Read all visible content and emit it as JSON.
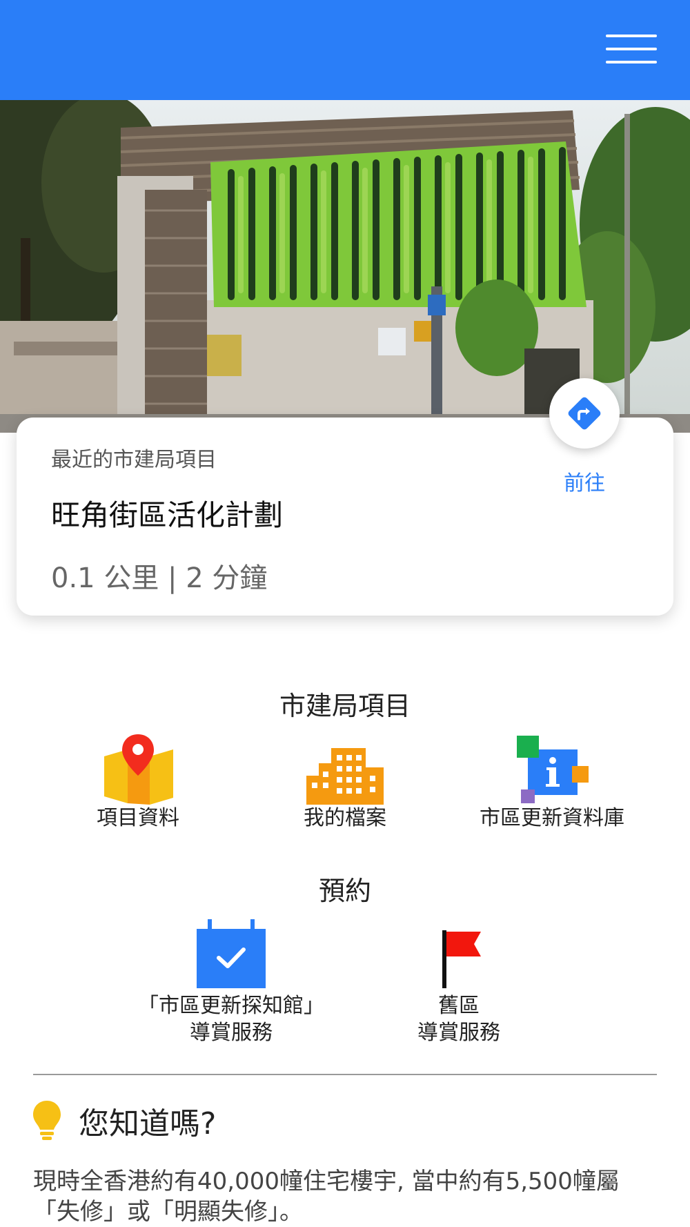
{
  "header": {
    "menu_icon": "hamburger-menu-icon",
    "background": "#2a7ef8"
  },
  "nearest_project": {
    "kicker": "最近的市建局項目",
    "name": "旺角街區活化計劃",
    "distance_time": "0.1 公里 | 2 分鐘",
    "go_label": "前往",
    "go_icon": "directions-icon"
  },
  "projects_section": {
    "title": "市建局項目",
    "items": [
      {
        "label": "項目資料",
        "icon": "map-pin-icon"
      },
      {
        "label": "我的檔案",
        "icon": "buildings-icon"
      },
      {
        "label": "市區更新資料庫",
        "icon": "info-database-icon"
      }
    ]
  },
  "booking_section": {
    "title": "預約",
    "items": [
      {
        "line1": "「市區更新探知館」",
        "line2": "導賞服務",
        "icon": "calendar-check-icon"
      },
      {
        "line1": "舊區",
        "line2": "導賞服務",
        "icon": "red-flag-icon"
      }
    ]
  },
  "did_you_know": {
    "title": "您知道嗎?",
    "icon": "lightbulb-icon",
    "line1": "現時全香港約有40,000幢住宅樓宇, 當中約有5,500幢屬",
    "line2": "「失修」或「明顯失修」。"
  },
  "colors": {
    "accent": "#2a7ef8",
    "orange": "#f59a10",
    "red": "#f22c1e",
    "yellow": "#f6c015"
  }
}
